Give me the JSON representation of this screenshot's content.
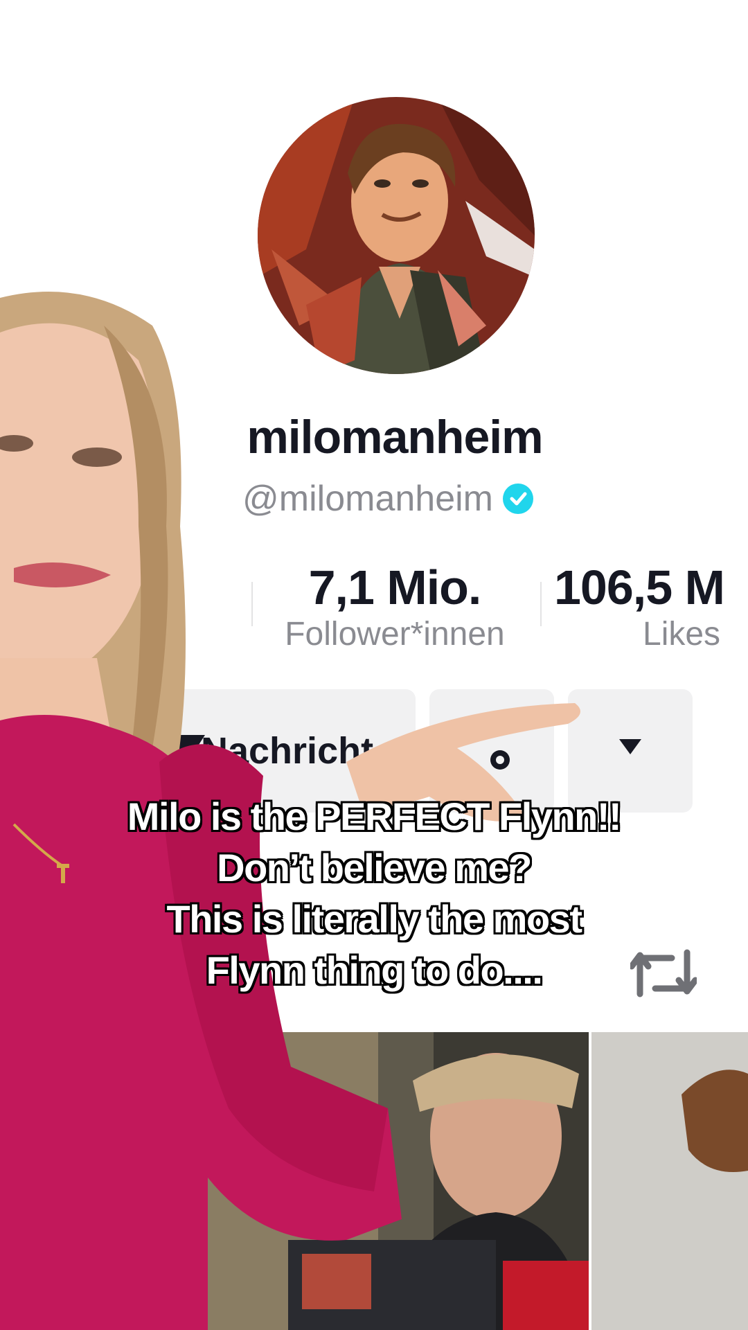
{
  "profile": {
    "display_name": "milomanheim",
    "handle": "@milomanheim",
    "verified": true
  },
  "stats": [
    {
      "value": "7,1 Mio.",
      "label": "Follower*innen"
    },
    {
      "value": "106,5 M",
      "label": "Likes"
    }
  ],
  "actions": {
    "message_label": "Nachricht",
    "more_icon": "triangle-down-icon",
    "add_friend_icon": "person-plus-icon"
  },
  "caption": {
    "lines": [
      "Milo is the PERFECT Flynn!!",
      "Don’t believe me?",
      "This is literally the most",
      "Flynn thing to do...."
    ]
  },
  "icons": {
    "repost": "repost-icon",
    "verified": "verified-check-icon"
  },
  "colors": {
    "text_primary": "#161823",
    "text_secondary": "#8a8b91",
    "verified": "#20d5ec",
    "button_bg": "#f1f1f2",
    "sweater": "#c2185b"
  }
}
